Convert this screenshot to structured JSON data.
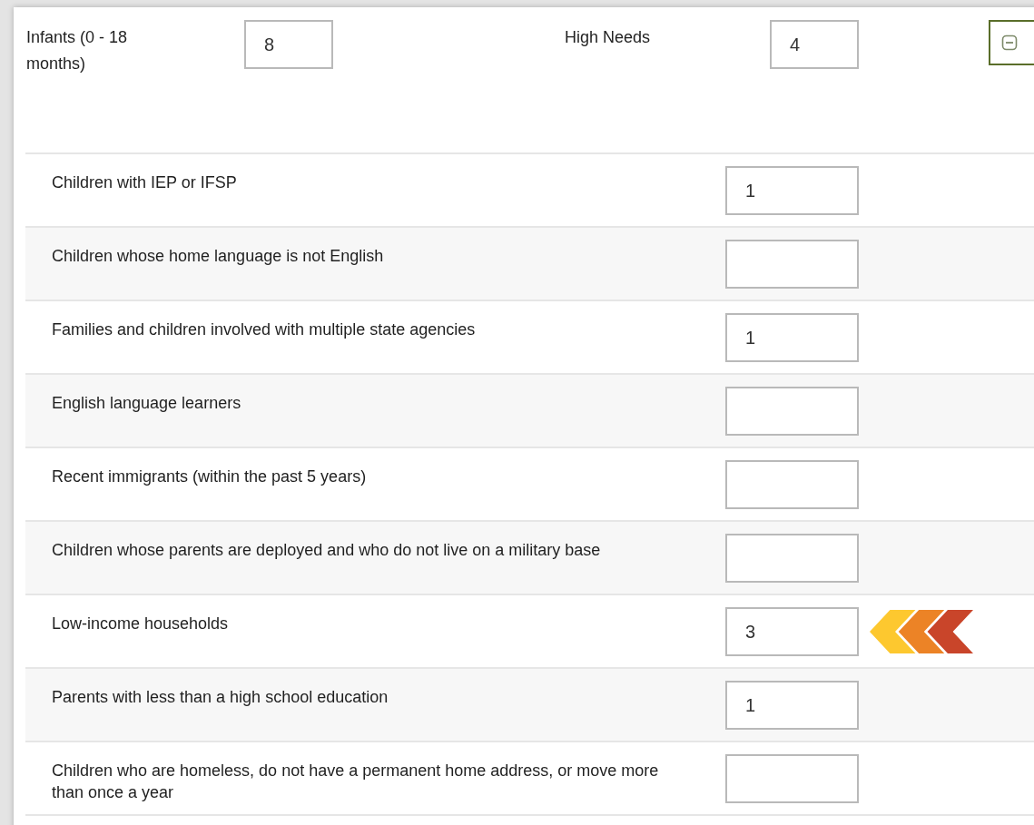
{
  "header": {
    "fields": [
      {
        "label": "Infants (0 - 18 months)",
        "value": "8"
      },
      {
        "label": "High Needs",
        "value": "4"
      }
    ],
    "collapse_button": {
      "expanded": true
    }
  },
  "rows": [
    {
      "label": "Children with IEP or IFSP",
      "value": "1",
      "flagged": false
    },
    {
      "label": "Children whose home language is not English",
      "flagged": false
    },
    {
      "label": "Families and children involved with multiple state agencies",
      "value": "1",
      "flagged": false
    },
    {
      "label": "English language learners",
      "flagged": false
    },
    {
      "label": "Recent immigrants (within the past 5 years)",
      "flagged": false
    },
    {
      "label": "Children whose parents are deployed and who do not live on a military base",
      "flagged": false
    },
    {
      "label": "Low-income households",
      "value": "3",
      "flagged": true
    },
    {
      "label": "Parents with less than a high school education",
      "value": "1",
      "flagged": false
    },
    {
      "label": "Children who are homeless, do not have a permanent home address, or move more than once a year",
      "flagged": false
    }
  ]
}
